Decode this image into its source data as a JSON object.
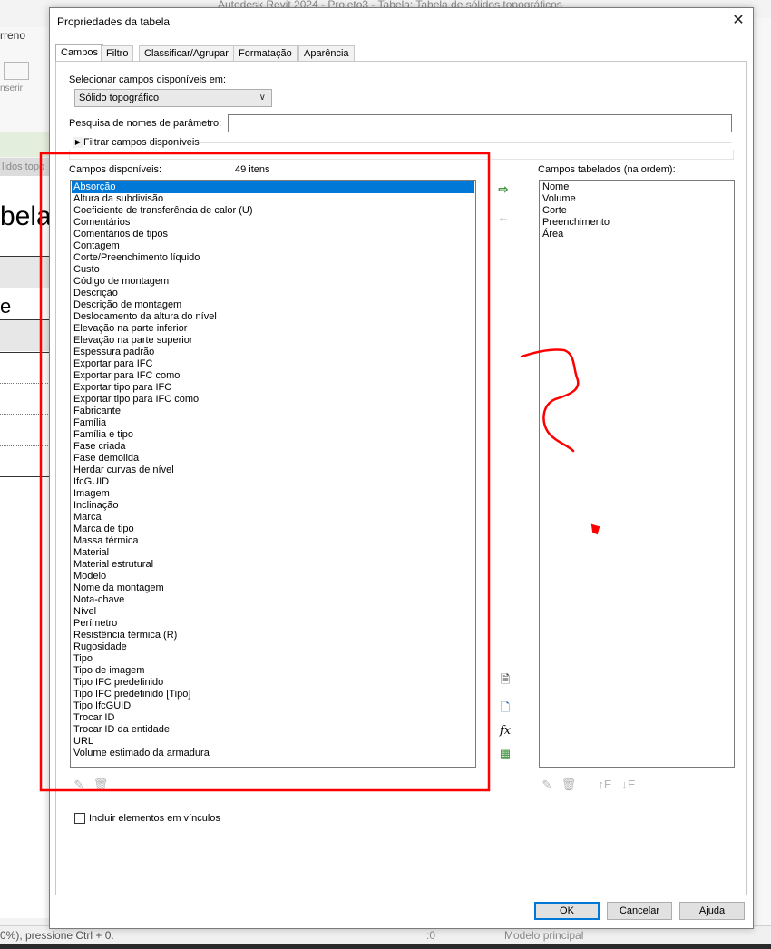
{
  "background": {
    "app_title": "Autodesk Revit 2024 - Projeto3 - Tabela: Tabela de sólidos topográficos",
    "ribbon_tab": "rreno",
    "ribbon_insert": "nserir",
    "view_tab": "lidos topo",
    "sheet_title_fragment": "bela",
    "sheet_cell_fragment": "e",
    "status_text": "0%), pressione Ctrl + 0.",
    "status_zero": ":0",
    "status_model": "Modelo principal"
  },
  "dialog": {
    "title": "Propriedades da tabela",
    "close_label": "✕",
    "tabs": [
      {
        "label": "Campos",
        "active": true
      },
      {
        "label": "Filtro",
        "active": false
      },
      {
        "label": "Classificar/Agrupar",
        "active": false
      },
      {
        "label": "Formatação",
        "active": false
      },
      {
        "label": "Aparência",
        "active": false
      }
    ],
    "select_fields_label": "Selecionar campos disponíveis em:",
    "select_fields_value": "Sólido topográfico",
    "search_label": "Pesquisa de nomes de parâmetro:",
    "search_value": "",
    "filter_toggle_label": "Filtrar campos disponíveis",
    "available_label": "Campos disponíveis:",
    "available_count": "49 itens",
    "scheduled_label": "Campos tabelados (na ordem):",
    "available_fields": [
      "Absorção",
      "Altura da subdivisão",
      "Coeficiente de transferência de calor (U)",
      "Comentários",
      "Comentários de tipos",
      "Contagem",
      "Corte/Preenchimento líquido",
      "Custo",
      "Código de montagem",
      "Descrição",
      "Descrição de montagem",
      "Deslocamento da altura do nível",
      "Elevação na parte inferior",
      "Elevação na parte superior",
      "Espessura padrão",
      "Exportar para IFC",
      "Exportar para IFC como",
      "Exportar tipo para IFC",
      "Exportar tipo para IFC como",
      "Fabricante",
      "Família",
      "Família e tipo",
      "Fase criada",
      "Fase demolida",
      "Herdar curvas de nível",
      "IfcGUID",
      "Imagem",
      "Inclinação",
      "Marca",
      "Marca de tipo",
      "Massa térmica",
      "Material",
      "Material estrutural",
      "Modelo",
      "Nome da montagem",
      "Nota-chave",
      "Nível",
      "Perímetro",
      "Resistência térmica (R)",
      "Rugosidade",
      "Tipo",
      "Tipo de imagem",
      "Tipo IFC predefinido",
      "Tipo IFC predefinido [Tipo]",
      "Tipo IfcGUID",
      "Trocar ID",
      "Trocar ID da entidade",
      "URL",
      "Volume estimado da armadura"
    ],
    "selected_available_index": 0,
    "scheduled_fields": [
      "Nome",
      "Volume",
      "Corte",
      "Preenchimento",
      "Área"
    ],
    "include_links_label": "Incluir elementos em vínculos",
    "include_links_checked": false,
    "ok_label": "OK",
    "cancel_label": "Cancelar",
    "help_label": "Ajuda",
    "icons": {
      "add_parameter": "add-parameter-icon",
      "remove_parameter": "remove-parameter-icon",
      "new_parameter": "new-parameter-icon",
      "combine_parameters": "combine-parameters-icon",
      "calculated_value": "fx",
      "add_shared_parameter": "add-shared-parameter-icon",
      "edit": "pencil-icon",
      "delete": "delete-parameter-icon",
      "move_up": "move-up-icon",
      "move_down": "move-down-icon"
    }
  },
  "annotation": {
    "color": "#ff0000",
    "accent": "#0078d7"
  }
}
